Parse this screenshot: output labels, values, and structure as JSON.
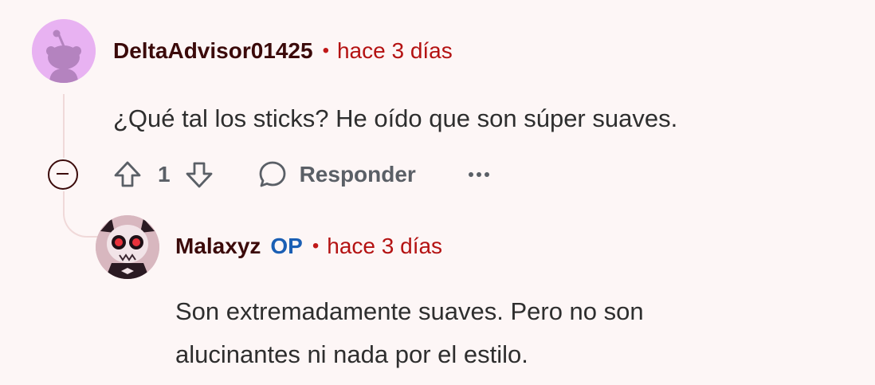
{
  "comments": [
    {
      "author": "DeltaAdvisor01425",
      "separator": "•",
      "time": "hace 3 días",
      "body": "¿Qué tal los sticks? He oído que son súper suaves.",
      "score": "1",
      "reply_label": "Responder"
    },
    {
      "author": "Malaxyz",
      "op_badge": "OP",
      "separator": "•",
      "time": "hace 3 días",
      "body_lines": [
        "Son extremadamente suaves. Pero no son",
        "alucinantes ni nada por el estilo."
      ]
    }
  ],
  "icons": {
    "avatar_1": "reddit-snoo-avatar-icon",
    "avatar_2": "skull-character-avatar",
    "collapse": "collapse-minus-icon",
    "upvote": "arrow-up-icon",
    "downvote": "arrow-down-icon",
    "reply": "speech-bubble-icon",
    "more": "ellipsis-icon"
  },
  "colors": {
    "background": "#fdf6f6",
    "username": "#3b0a0a",
    "timestamp": "#b41212",
    "op_badge": "#1b5fb4",
    "action_gray": "#5a5f66"
  }
}
